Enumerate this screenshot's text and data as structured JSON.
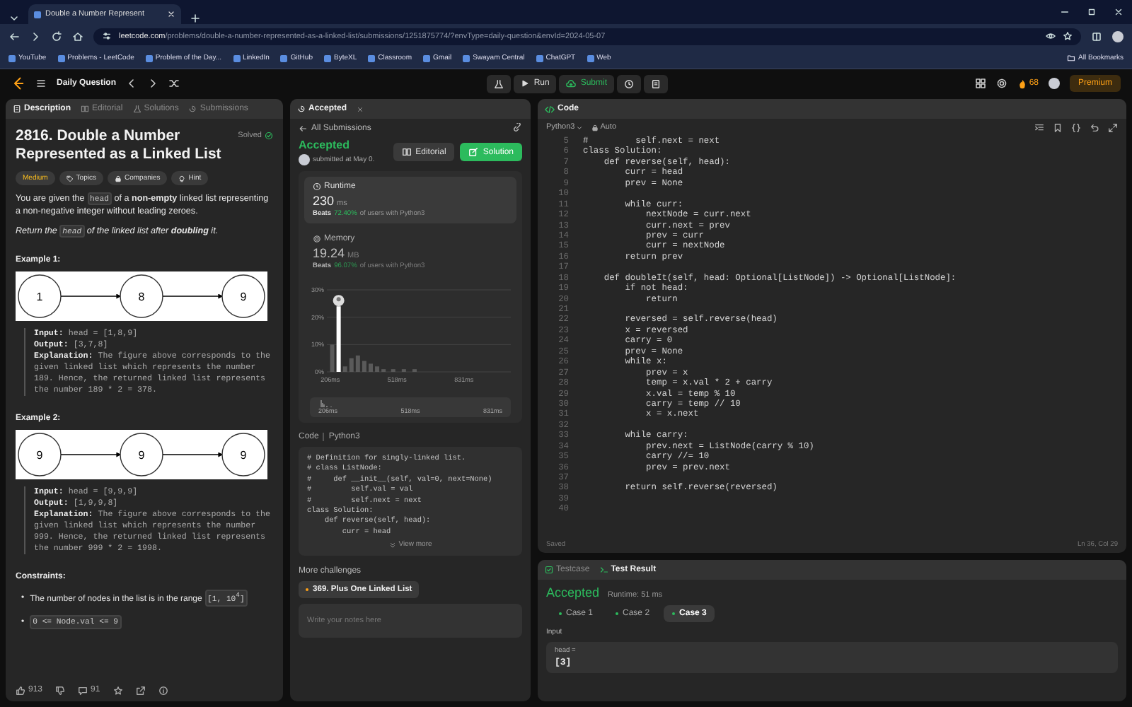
{
  "browser": {
    "tab_title": "Double a Number Represent",
    "url_host": "leetcode.com",
    "url_path": "/problems/double-a-number-represented-as-a-linked-list/submissions/1251875774/?envType=daily-question&envId=2024-05-07",
    "bookmarks": [
      {
        "label": "YouTube"
      },
      {
        "label": "Problems - LeetCode"
      },
      {
        "label": "Problem of the Day..."
      },
      {
        "label": "LinkedIn"
      },
      {
        "label": "GitHub"
      },
      {
        "label": "ByteXL"
      },
      {
        "label": "Classroom"
      },
      {
        "label": "Gmail"
      },
      {
        "label": "Swayam Central"
      },
      {
        "label": "ChatGPT"
      },
      {
        "label": "Web"
      }
    ],
    "all_bookmarks": "All Bookmarks"
  },
  "nav": {
    "title": "Daily Question",
    "run": "Run",
    "submit": "Submit",
    "streak": "68",
    "premium": "Premium"
  },
  "description": {
    "tabs": [
      {
        "label": "Description",
        "selected": true
      },
      {
        "label": "Editorial",
        "selected": false
      },
      {
        "label": "Solutions",
        "selected": false
      },
      {
        "label": "Submissions",
        "selected": false
      }
    ],
    "title": "2816. Double a Number Represented as a Linked List",
    "status": "Solved",
    "difficulty": "Medium",
    "tags": [
      "Topics",
      "Companies",
      "Hint"
    ],
    "paragraphs": [
      {
        "italic": false,
        "parts": [
          {
            "kind": "text",
            "text": "You are given the "
          },
          {
            "kind": "code",
            "text": "head"
          },
          {
            "kind": "text",
            "text": " of a **non-empty** linked list representing a non-negative integer without leading zeroes."
          }
        ]
      },
      {
        "italic": true,
        "parts": [
          {
            "kind": "text",
            "text": "Return the "
          },
          {
            "kind": "code",
            "text": "head"
          },
          {
            "kind": "text",
            "text": " of the linked list after **doubling** it."
          }
        ]
      }
    ],
    "examples": [
      {
        "heading": "Example 1:",
        "nodes": [
          "1",
          "8",
          "9"
        ],
        "lines": [
          {
            "label": "Input:",
            "value": "head = [1,8,9]"
          },
          {
            "label": "Output:",
            "value": "[3,7,8]"
          },
          {
            "label": "Explanation:",
            "value": "The figure above corresponds to the given linked list which represents the number 189. Hence, the returned linked list represents the number 189 * 2 = 378."
          }
        ]
      },
      {
        "heading": "Example 2:",
        "nodes": [
          "9",
          "9",
          "9"
        ],
        "lines": [
          {
            "label": "Input:",
            "value": "head = [9,9,9]"
          },
          {
            "label": "Output:",
            "value": "[1,9,9,8]"
          },
          {
            "label": "Explanation:",
            "value": "The figure above corresponds to the given linked list which represents the number 999. Hence, the returned linked list represents the number 999 * 2 = 1998."
          }
        ]
      }
    ],
    "constraints_heading": "Constraints:",
    "constraints": [
      {
        "marker": "•",
        "parts": [
          {
            "kind": "text",
            "text": "The number of nodes in the list is in the range "
          },
          {
            "kind": "code",
            "text": "[1, 10$^{4}$]"
          }
        ]
      },
      {
        "marker": "•",
        "parts": [
          {
            "kind": "code",
            "text": "0 <= Node.val <= 9"
          }
        ]
      }
    ],
    "footer": {
      "likes": "913",
      "comments": "91"
    }
  },
  "submission": {
    "tab": "Accepted",
    "back": "All Submissions",
    "status": "Accepted",
    "submitted": "submitted at May 0.",
    "buttons": [
      {
        "label": "Editorial",
        "kind": "secondary"
      },
      {
        "label": "Solution",
        "kind": "primary"
      }
    ],
    "metrics": [
      {
        "label": "Runtime",
        "value": "230",
        "unit": "ms",
        "beats": "Beats",
        "percent": "72.40%",
        "suffix": "of users with Python3",
        "selected": true
      },
      {
        "label": "Memory",
        "value": "19.24",
        "unit": "MB",
        "beats": "Beats",
        "percent": "96.07%",
        "suffix": "of users with Python3",
        "selected": false
      }
    ],
    "chart_data": {
      "type": "bar",
      "x": [
        215,
        245,
        275,
        305,
        335,
        365,
        395,
        425,
        455,
        500,
        550,
        600
      ],
      "values": [
        10,
        24,
        2,
        5,
        6,
        4,
        3,
        2,
        1,
        1,
        1,
        1
      ],
      "xlim": [
        190,
        1050
      ],
      "ylim": [
        0,
        30
      ],
      "yticks": [
        {
          "value": 0,
          "label": "0%"
        },
        {
          "value": 10,
          "label": "10%"
        },
        {
          "value": 20,
          "label": "20%"
        },
        {
          "value": 30,
          "label": "30%"
        }
      ],
      "xticks": [
        {
          "value": 206,
          "label": "206ms"
        },
        {
          "value": 518,
          "label": "518ms"
        },
        {
          "value": 831,
          "label": "831ms"
        }
      ]
    },
    "overview_labels": [
      "206ms",
      "518ms",
      "831ms"
    ],
    "code_label": "Code",
    "code_language": "Python3",
    "code_lines": [
      "# Definition for singly-linked list.",
      "# class ListNode:",
      "#     def __init__(self, val=0, next=None)",
      "#         self.val = val",
      "#         self.next = next",
      "class Solution:",
      "    def reverse(self, head):",
      "        curr = head"
    ],
    "view_more": "View more",
    "more_heading": "More challenges",
    "challenges": [
      {
        "label": "369. Plus One Linked List"
      }
    ],
    "notes_placeholder": "Write your notes here"
  },
  "editor": {
    "title": "Code",
    "language": "Python3",
    "mode": "Auto",
    "lines": [
      {
        "number": "5",
        "text": "#         self.next = next"
      },
      {
        "number": "6",
        "text": "class Solution:"
      },
      {
        "number": "7",
        "text": "    def reverse(self, head):"
      },
      {
        "number": "8",
        "text": "        curr = head"
      },
      {
        "number": "9",
        "text": "        prev = None"
      },
      {
        "number": "10"
      },
      {
        "number": "11",
        "text": "        while curr:"
      },
      {
        "number": "12",
        "text": "            nextNode = curr.next"
      },
      {
        "number": "13",
        "text": "            curr.next = prev"
      },
      {
        "number": "14",
        "text": "            prev = curr"
      },
      {
        "number": "15",
        "text": "            curr = nextNode"
      },
      {
        "number": "16",
        "text": "        return prev"
      },
      {
        "number": "17"
      },
      {
        "number": "18",
        "text": "    def doubleIt(self, head: Optional[ListNode]) -> Optional[ListNode]:"
      },
      {
        "number": "19",
        "text": "        if not head:"
      },
      {
        "number": "20",
        "text": "            return"
      },
      {
        "number": "21"
      },
      {
        "number": "22",
        "text": "        reversed = self.reverse(head)"
      },
      {
        "number": "23",
        "text": "        x = reversed"
      },
      {
        "number": "24",
        "text": "        carry = 0"
      },
      {
        "number": "25",
        "text": "        prev = None"
      },
      {
        "number": "26",
        "text": "        while x:"
      },
      {
        "number": "27",
        "text": "            prev = x"
      },
      {
        "number": "28",
        "text": "            temp = x.val * 2 + carry"
      },
      {
        "number": "29",
        "text": "            x.val = temp % 10"
      },
      {
        "number": "30",
        "text": "            carry = temp // 10"
      },
      {
        "number": "31",
        "text": "            x = x.next"
      },
      {
        "number": "32"
      },
      {
        "number": "33",
        "text": "        while carry:"
      },
      {
        "number": "34",
        "text": "            prev.next = ListNode(carry % 10)"
      },
      {
        "number": "35",
        "text": "            carry //= 10"
      },
      {
        "number": "36",
        "text": "            prev = prev.next"
      },
      {
        "number": "37"
      },
      {
        "number": "38",
        "text": "        return self.reverse(reversed)"
      },
      {
        "number": "39"
      },
      {
        "number": "40"
      }
    ],
    "status": "Saved",
    "cursor": "Ln 36, Col 29"
  },
  "console": {
    "tabs": [
      {
        "label": "Testcase",
        "selected": false
      },
      {
        "label": "Test Result",
        "selected": true
      }
    ],
    "status": "Accepted",
    "runtime": "Runtime: 51 ms",
    "cases": [
      {
        "label": "Case 1",
        "selected": false
      },
      {
        "label": "Case 2",
        "selected": false
      },
      {
        "label": "Case 3",
        "selected": true
      }
    ],
    "input_heading": "Input",
    "input_name": "head =",
    "input_value": "[3]"
  }
}
